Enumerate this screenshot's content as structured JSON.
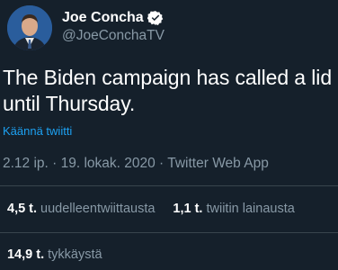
{
  "author": {
    "display_name": "Joe Concha",
    "handle": "@JoeConchaTV",
    "verified": true
  },
  "tweet": {
    "text": "The Biden campaign has called a lid until Thursday.",
    "translate_label": "Käännä twiitti",
    "meta": "2.12 ip. · 19. lokak. 2020 · Twitter Web App"
  },
  "stats": {
    "retweets": {
      "count": "4,5 t.",
      "label": "uudelleentwiittausta"
    },
    "quotes": {
      "count": "1,1 t.",
      "label": "twiitin lainausta"
    },
    "likes": {
      "count": "14,9 t.",
      "label": "tykkäystä"
    }
  },
  "colors": {
    "background": "#15202b",
    "text": "#ffffff",
    "secondary": "#8899a6",
    "accent": "#1da1f2",
    "divider": "#38444d"
  }
}
